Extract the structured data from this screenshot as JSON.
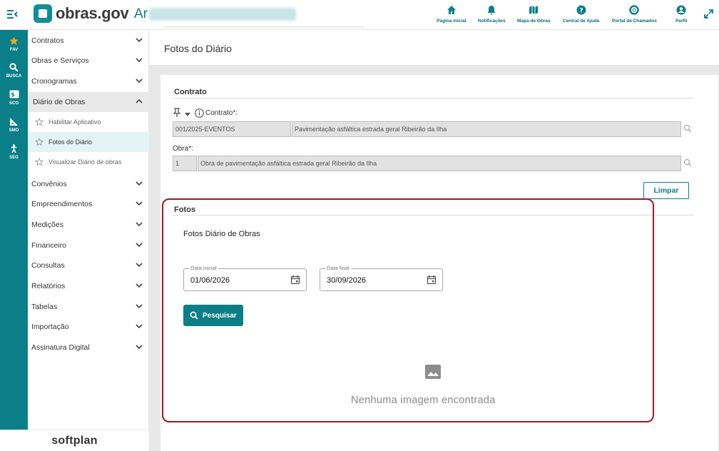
{
  "header": {
    "logo_text": "obras.gov",
    "environment_visible": "Ar",
    "nav": [
      {
        "label": "Página inicial",
        "icon": "home-icon"
      },
      {
        "label": "Notificações",
        "icon": "bell-icon"
      },
      {
        "label": "Mapa de Obras",
        "icon": "map-icon"
      },
      {
        "label": "Central de Ajuda",
        "icon": "help-icon"
      },
      {
        "label": "Portal de Chamados",
        "icon": "lifebuoy-icon"
      },
      {
        "label": "Perfil",
        "icon": "user-icon"
      }
    ]
  },
  "rail": [
    {
      "label": "FAV",
      "icon": "star-icon"
    },
    {
      "label": "BUSCA",
      "icon": "search-icon"
    },
    {
      "label": "SCO",
      "icon": "money-icon"
    },
    {
      "label": "SMO",
      "icon": "ruler-icon"
    },
    {
      "label": "SEG",
      "icon": "person-icon"
    }
  ],
  "sidebar": {
    "items": [
      {
        "label": "Contratos"
      },
      {
        "label": "Obras e Serviços"
      },
      {
        "label": "Cronogramas"
      },
      {
        "label": "Diário de Obras"
      },
      {
        "label": "Convênios"
      },
      {
        "label": "Empreendimentos"
      },
      {
        "label": "Medições"
      },
      {
        "label": "Financeiro"
      },
      {
        "label": "Consultas"
      },
      {
        "label": "Relatórios"
      },
      {
        "label": "Tabelas"
      },
      {
        "label": "Importação"
      },
      {
        "label": "Assinatura Digital"
      }
    ],
    "subitems": [
      {
        "label": "Habilitar Aplicativo"
      },
      {
        "label": "Fotos do Diário"
      },
      {
        "label": "Visualizar Diário de obras"
      }
    ],
    "footer": "softplan"
  },
  "page": {
    "title": "Fotos do Diário",
    "contrato_section": "Contrato",
    "contrato_label": "Contrato*:",
    "contrato_code": "001/2025-EVENTOS",
    "contrato_desc": "Pavimentação asfáltica estrada geral Ribeirão da Ilha",
    "obra_label": "Obra*:",
    "obra_code": "1",
    "obra_desc": "Obra de pavimentação asfáltica estrada geral Ribeirão da Ilha",
    "limpar_label": "Limpar",
    "fotos_section": "Fotos",
    "fotos_subtitle": "Fotos Diário de Obras",
    "data_inicial_label": "Data inicial",
    "data_inicial_value": "01/06/2026",
    "data_final_label": "Data final",
    "data_final_value": "30/09/2026",
    "pesquisar_label": "Pesquisar",
    "empty_text": "Nenhuma imagem encontrada"
  },
  "colors": {
    "brand": "#0a7f88",
    "highlight": "#a01822"
  }
}
